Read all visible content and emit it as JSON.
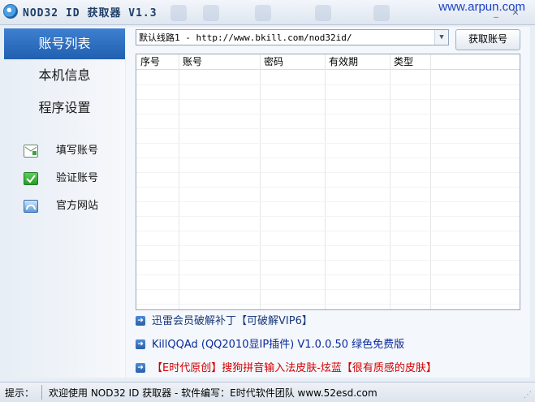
{
  "window": {
    "title": "NOD32 ID 获取器 V1.3",
    "watermark": "www.arpun.com"
  },
  "sidebar": {
    "nav": [
      {
        "label": "账号列表",
        "active": true
      },
      {
        "label": "本机信息",
        "active": false
      },
      {
        "label": "程序设置",
        "active": false
      }
    ],
    "actions": [
      {
        "label": "填写账号",
        "icon": "add-mail-icon"
      },
      {
        "label": "验证账号",
        "icon": "check-icon"
      },
      {
        "label": "官方网站",
        "icon": "ie-icon"
      }
    ]
  },
  "main": {
    "url_select": "默认线路1 - http://www.bkill.com/nod32id/",
    "fetch_button": "获取账号",
    "table": {
      "columns": [
        "序号",
        "账号",
        "密码",
        "有效期",
        "类型"
      ]
    },
    "links": [
      {
        "text": "迅雷会员破解补丁【可破解VIP6】",
        "color": "#1a3a7a"
      },
      {
        "text": "KillQQAd (QQ2010显IP插件) V1.0.0.50 绿色免费版",
        "color": "#0a2a9a"
      },
      {
        "text": "【E时代原创】搜狗拼音输入法皮肤-炫蓝【很有质感的皮肤】",
        "color": "#d40000"
      }
    ]
  },
  "statusbar": {
    "label": "提示：",
    "message": "欢迎使用 NOD32 ID 获取器 - 软件编写：E时代软件团队 www.52esd.com"
  },
  "colors": {
    "accent": "#2a67b8",
    "link_blue": "#0a2a9a",
    "link_red": "#d40000"
  }
}
